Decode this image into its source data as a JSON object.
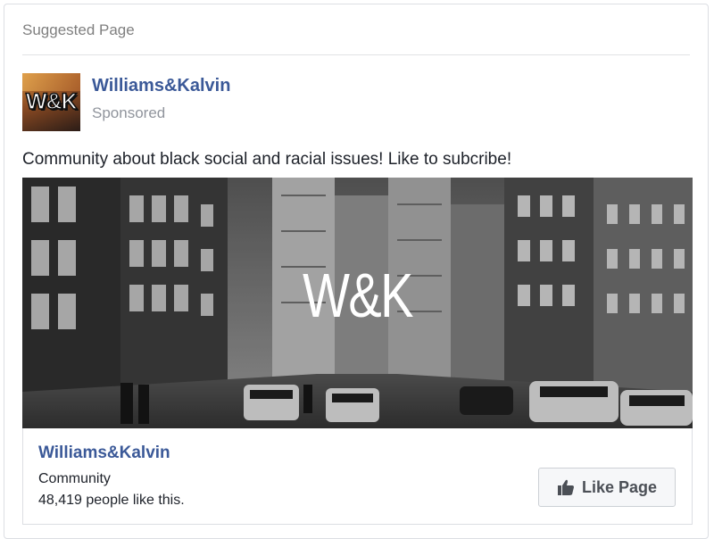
{
  "header": {
    "label": "Suggested Page"
  },
  "page": {
    "name": "Williams&Kalvin",
    "sponsored_label": "Sponsored",
    "avatar_text": "W&K"
  },
  "post": {
    "text": "Community about black social and racial issues! Like to subcribe!",
    "image_logo": "W&K"
  },
  "footer": {
    "name": "Williams&Kalvin",
    "category": "Community",
    "likes": "48,419 people like this.",
    "like_button_label": "Like Page"
  },
  "colors": {
    "link": "#3b5998",
    "muted": "#90949c",
    "text": "#1d2129",
    "border": "#dcdee3"
  },
  "icons": [
    "thumbs-up-icon"
  ]
}
